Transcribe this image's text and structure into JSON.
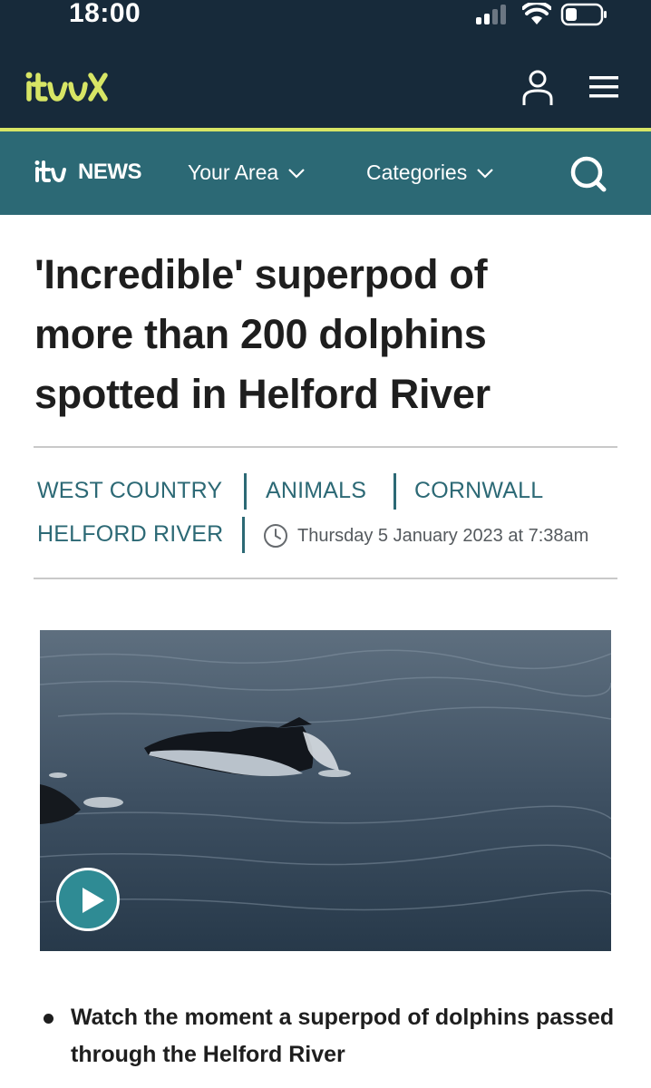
{
  "status_bar": {
    "time": "18:00",
    "icons": [
      "cellular-signal-icon",
      "wifi-icon",
      "battery-icon"
    ]
  },
  "header": {
    "brand": "itvX",
    "icons": [
      "user-icon",
      "menu-icon"
    ],
    "accent_color": "#d7e565",
    "background_color": "#172a3a"
  },
  "news_nav": {
    "logo_prefix": "itv",
    "logo_word": "NEWS",
    "items": [
      {
        "label": "Your Area"
      },
      {
        "label": "Categories"
      }
    ],
    "background_color": "#2c6975"
  },
  "article": {
    "headline_lines": [
      "'Incredible' superpod of",
      "more than 200 dolphins",
      "spotted in Helford River"
    ],
    "tags": [
      "WEST COUNTRY",
      "ANIMALS",
      "CORNWALL",
      "HELFORD RIVER"
    ],
    "timestamp": "Thursday 5 January 2023 at 7:38am",
    "video": {
      "play_icon": "play-icon"
    },
    "bullets": [
      "Watch the moment a superpod of dolphins passed through the Helford River"
    ]
  }
}
